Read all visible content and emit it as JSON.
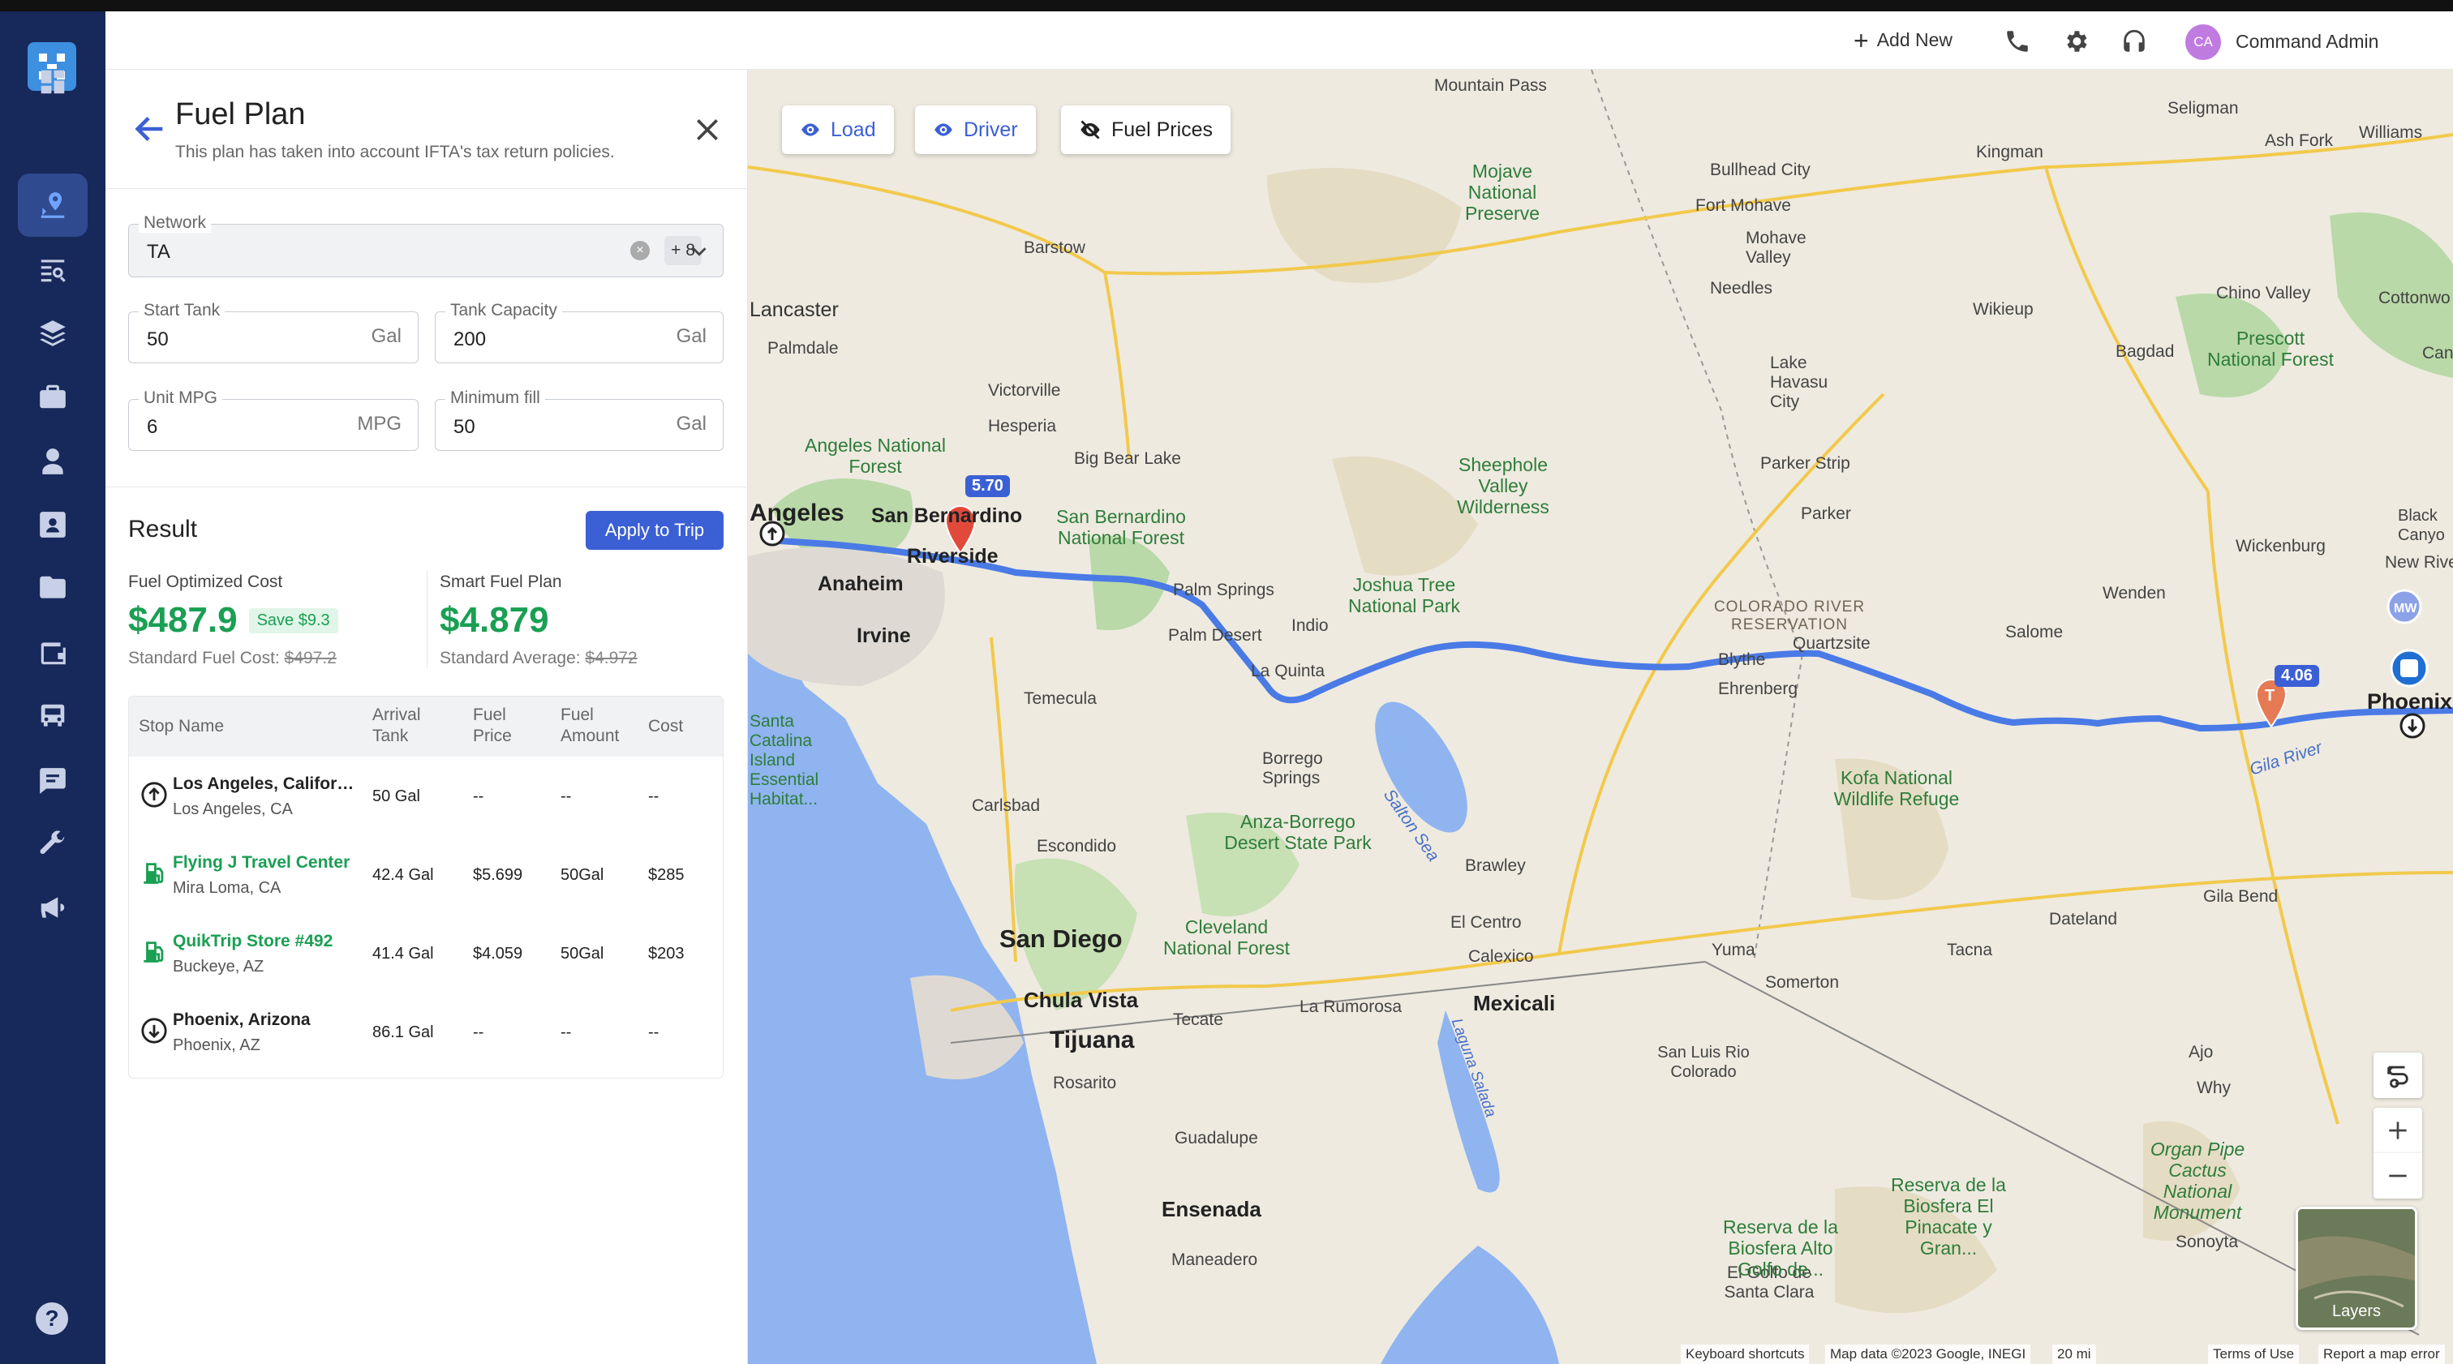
{
  "header": {
    "add_new_label": "Add New",
    "avatar_initials": "CA",
    "user_name": "Command Admin"
  },
  "panel": {
    "title": "Fuel Plan",
    "subtitle": "This plan has taken into account IFTA's tax return policies.",
    "network": {
      "label": "Network",
      "value": "TA",
      "more_count": "+ 8"
    },
    "start_tank": {
      "label": "Start Tank",
      "value": "50",
      "unit": "Gal"
    },
    "tank_capacity": {
      "label": "Tank Capacity",
      "value": "200",
      "unit": "Gal"
    },
    "unit_mpg": {
      "label": "Unit MPG",
      "value": "6",
      "unit": "MPG"
    },
    "minimum_fill": {
      "label": "Minimum fill",
      "value": "50",
      "unit": "Gal"
    }
  },
  "result": {
    "title": "Result",
    "apply_label": "Apply to Trip",
    "optimized": {
      "label": "Fuel Optimized Cost",
      "value": "$487.9",
      "save_badge": "Save $9.3",
      "std_label": "Standard Fuel Cost:",
      "std_value": "$497.2"
    },
    "smart": {
      "label": "Smart Fuel Plan",
      "value": "$4.879",
      "std_label": "Standard Average:",
      "std_value": "$4.972"
    }
  },
  "stops_table": {
    "headers": [
      "Stop Name",
      "Arrival\nTank",
      "Fuel\nPrice",
      "Fuel\nAmount",
      "Cost"
    ],
    "rows": [
      {
        "name": "Los Angeles, California",
        "location": "Los Angeles, CA",
        "arrival": "50 Gal",
        "price": "--",
        "amount": "--",
        "cost": "--",
        "icon": "start-icon"
      },
      {
        "name": "Flying J Travel Center",
        "location": "Mira Loma, CA",
        "arrival": "42.4 Gal",
        "price": "$5.699",
        "amount": "50Gal",
        "cost": "$285",
        "icon": "fuel-pump-icon"
      },
      {
        "name": "QuikTrip Store #492",
        "location": "Buckeye, AZ",
        "arrival": "41.4 Gal",
        "price": "$4.059",
        "amount": "50Gal",
        "cost": "$203",
        "icon": "fuel-pump-icon"
      },
      {
        "name": "Phoenix, Arizona",
        "location": "Phoenix, AZ",
        "arrival": "86.1 Gal",
        "price": "--",
        "amount": "--",
        "cost": "--",
        "icon": "end-icon"
      }
    ]
  },
  "map": {
    "buttons": {
      "load": "Load",
      "driver": "Driver",
      "fuel_prices": "Fuel Prices"
    },
    "price_pins": [
      "5.70",
      "4.06"
    ],
    "labels": [
      "Mountain Pass",
      "Seligman",
      "Kingman",
      "Bullhead City",
      "Fort Mohave",
      "Mohave Valley",
      "Needles",
      "Barstow",
      "Lancaster",
      "Palmdale",
      "Victorville",
      "Hesperia",
      "Big Bear Lake",
      "Angeles",
      "San Bernardino",
      "Riverside",
      "Anaheim",
      "Irvine",
      "Palm Springs",
      "Palm Desert",
      "Indio",
      "La Quinta",
      "Blythe",
      "Ehrenberg",
      "Quartzsite",
      "Salome",
      "Wenden",
      "Wickenburg",
      "Parker",
      "Parker Strip",
      "Lake Havasu City",
      "Wikieup",
      "Bagdad",
      "Chino Valley",
      "Prescott National Forest",
      "Temecula",
      "Carlsbad",
      "Escondido",
      "San Diego",
      "Chula Vista",
      "Tijuana",
      "Rosarito",
      "Tecate",
      "La Rumorosa",
      "Mexicali",
      "Calexico",
      "El Centro",
      "Brawley",
      "Yuma",
      "Somerton",
      "San Luis Rio Colorado",
      "Tacna",
      "Dateland",
      "Gila Bend",
      "Ajo",
      "Why",
      "Sonoyta",
      "Guadalupe",
      "Ensenada",
      "Maneadero",
      "El Golfo de Santa Clara",
      "Borrego Springs",
      "Mojave National Preserve",
      "Sheephole Valley Wilderness",
      "Joshua Tree National Park",
      "Angeles National Forest",
      "San Bernardino National Forest",
      "Anza-Borrego Desert State Park",
      "Cleveland National Forest",
      "Kofa National Wildlife Refuge",
      "Reserva de la Biosfera El Pinacate y Gran...",
      "Organ Pipe Cactus National Monument",
      "Reserva de la Biosfera Alto Golfo de...",
      "COLORADO RIVER RESERVATION",
      "Salton Sea",
      "Laguna Salada",
      "Gila River",
      "Phoenix",
      "Black Canyo",
      "New River",
      "Ash Fork",
      "Williams",
      "Cottonwo",
      "Can",
      "Santa Catalina Island Essential Habitat..."
    ],
    "layers_label": "Layers",
    "attribution": [
      "Keyboard shortcuts",
      "Map data ©2023 Google, INEGI",
      "20 mi",
      "Terms of Use",
      "Report a map error"
    ]
  },
  "colors": {
    "rail": "#17285a",
    "accent": "#3b5fd4",
    "green": "#1a9f53",
    "route": "#4a7ae6"
  }
}
